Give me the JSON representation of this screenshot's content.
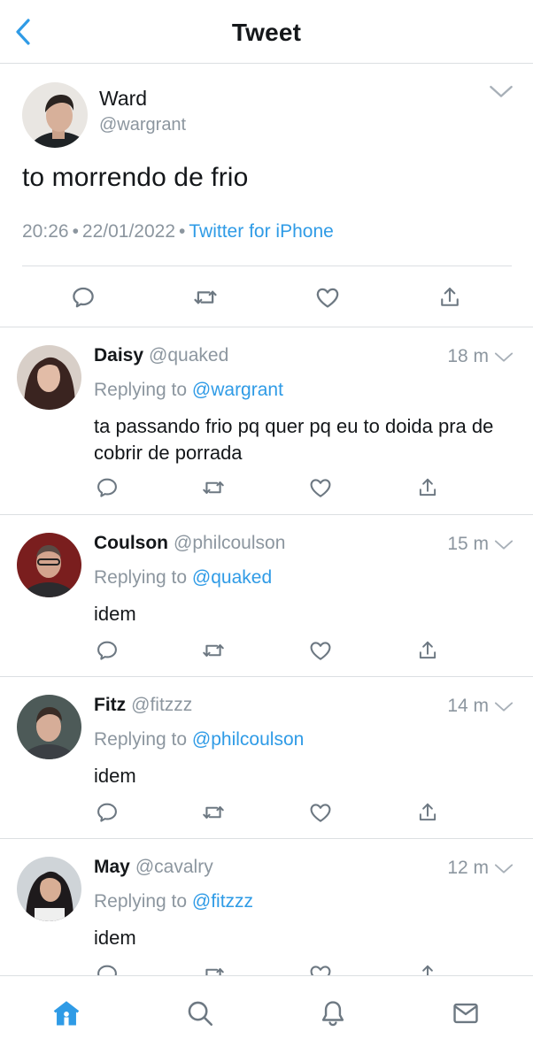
{
  "header": {
    "title": "Tweet"
  },
  "main_tweet": {
    "name": "Ward",
    "handle": "@wargrant",
    "text": "to morrendo de frio",
    "time": "20:26",
    "dot": "•",
    "date": "22/01/2022",
    "source": "Twitter for iPhone"
  },
  "replies": [
    {
      "name": "Daisy",
      "handle": "@quaked",
      "time": "18 m",
      "replying_label": "Replying to",
      "replying_to": "@wargrant",
      "text": "ta passando frio pq quer pq eu to doida pra de cobrir de porrada"
    },
    {
      "name": "Coulson",
      "handle": "@philcoulson",
      "time": "15 m",
      "replying_label": "Replying to",
      "replying_to": "@quaked",
      "text": "idem"
    },
    {
      "name": "Fitz",
      "handle": "@fitzzz",
      "time": "14 m",
      "replying_label": "Replying to",
      "replying_to": "@philcoulson",
      "text": "idem"
    },
    {
      "name": "May",
      "handle": "@cavalry",
      "time": "12 m",
      "replying_label": "Replying to",
      "replying_to": "@fitzzz",
      "text": "idem"
    }
  ],
  "icons": {
    "back": "chevron-left-icon",
    "caret": "chevron-down-icon",
    "reply": "reply-icon",
    "retweet": "retweet-icon",
    "like": "heart-icon",
    "share": "share-icon",
    "home": "home-icon",
    "search": "search-icon",
    "notifications": "bell-icon",
    "messages": "mail-icon"
  },
  "colors": {
    "accent": "#2f9be6",
    "text": "#14171a",
    "secondary": "#8c969f",
    "icon": "#6d7882",
    "divider": "#dcdfe2"
  }
}
